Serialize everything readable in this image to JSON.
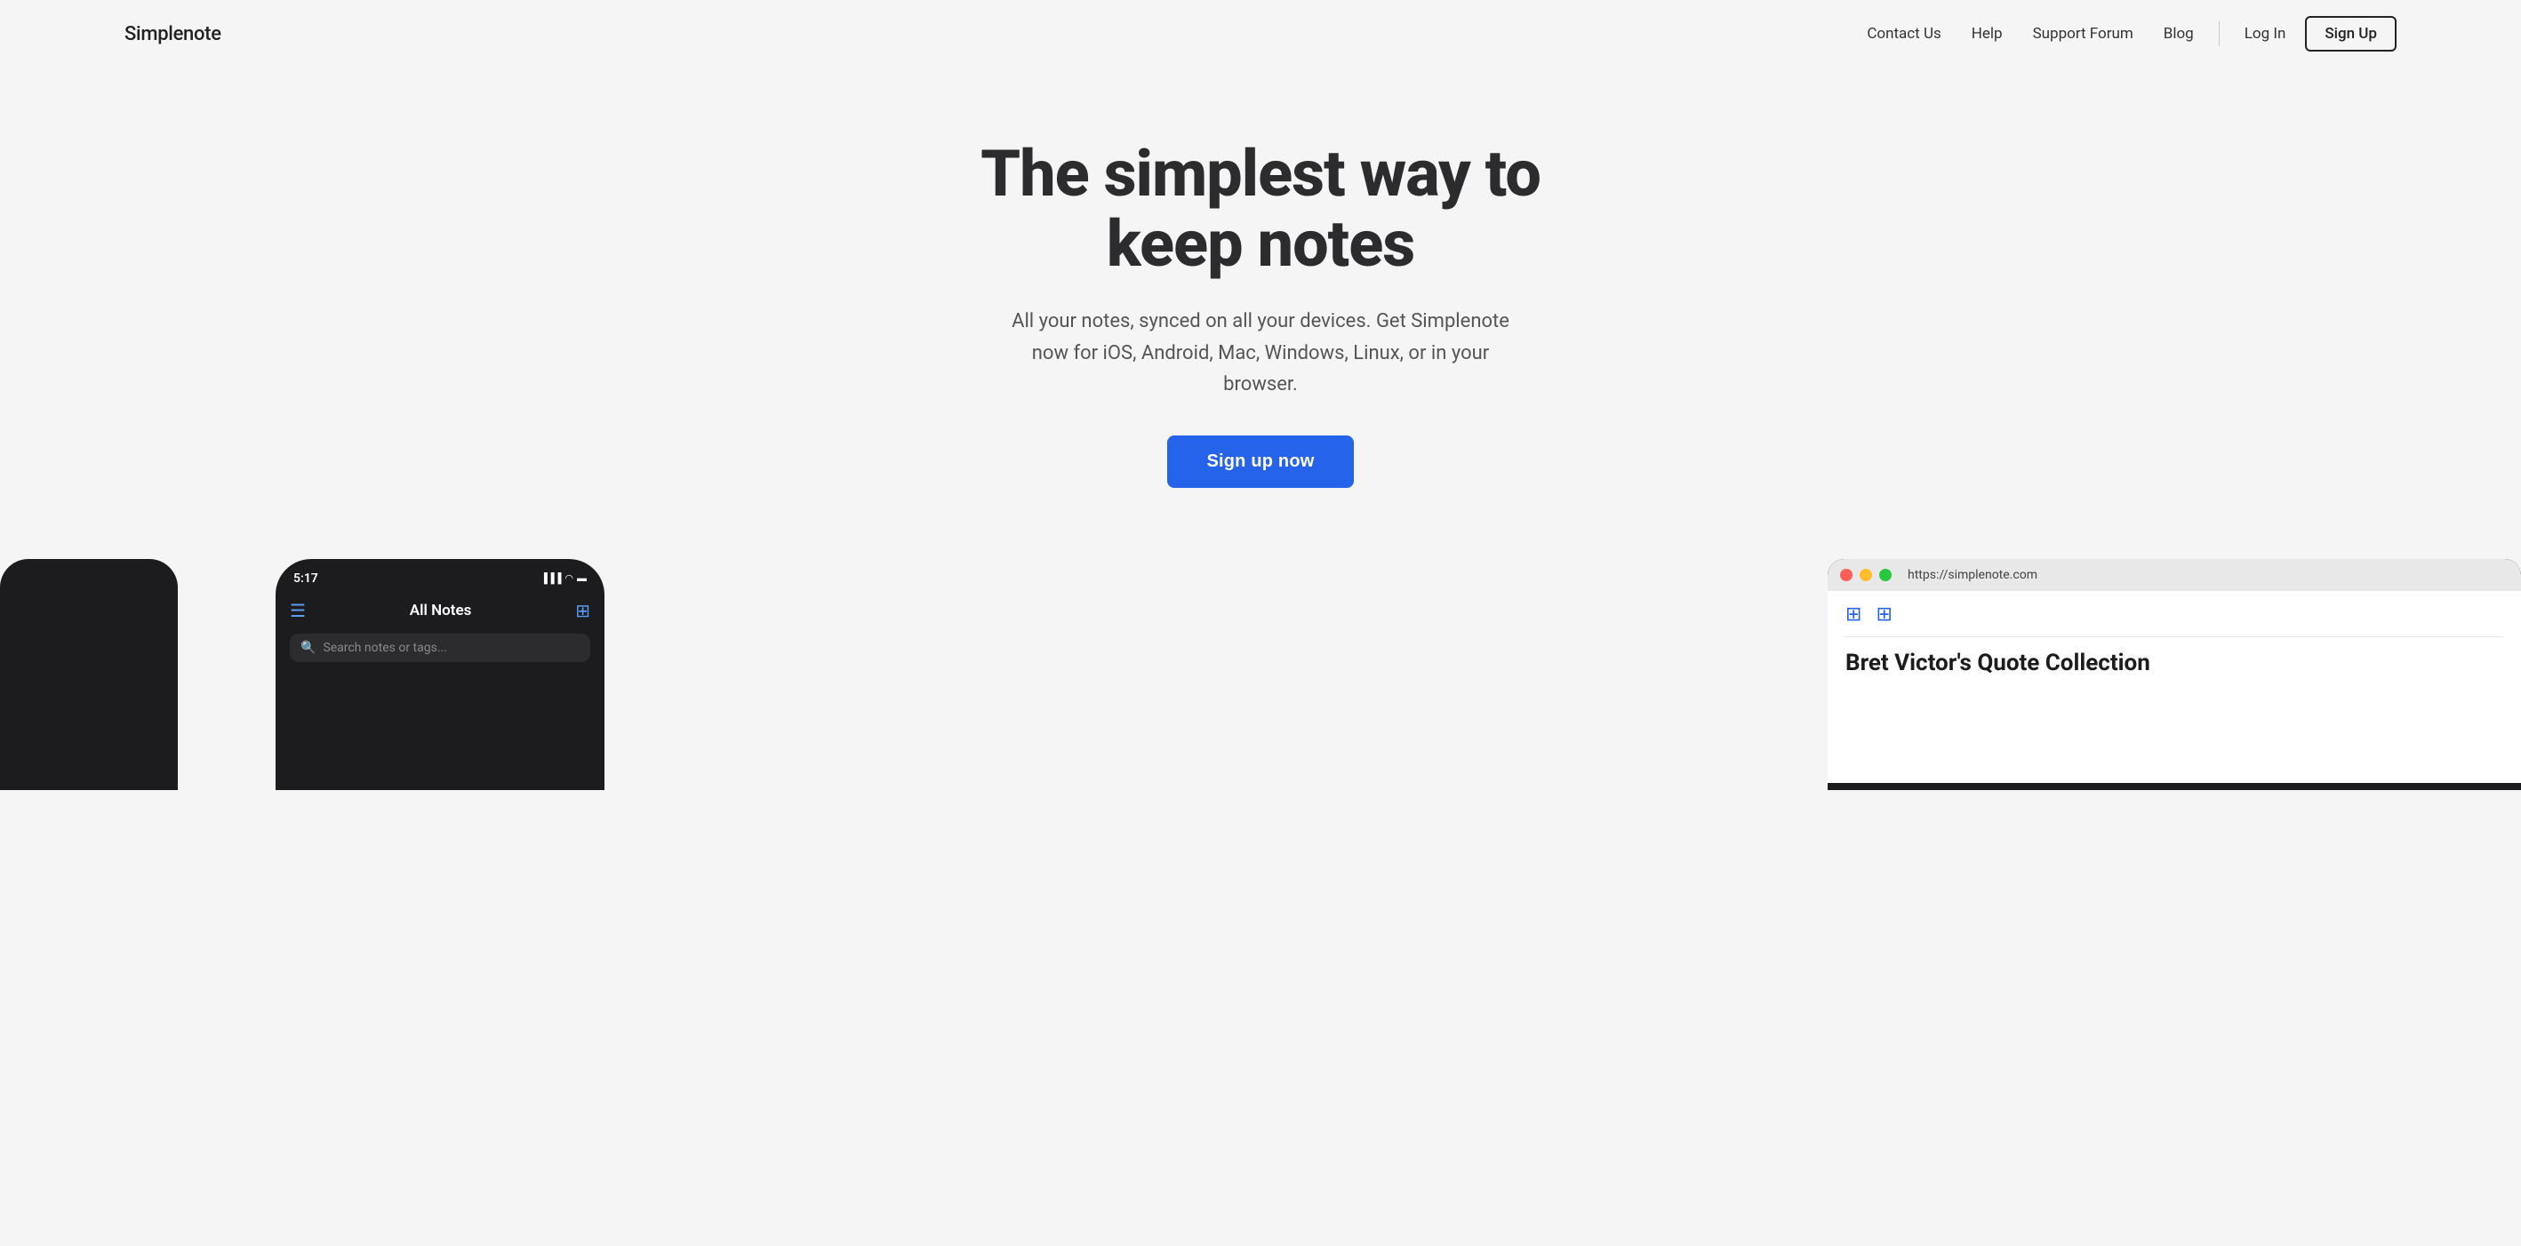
{
  "nav": {
    "logo": "Simplenote",
    "links": [
      {
        "id": "contact-us",
        "label": "Contact Us"
      },
      {
        "id": "help",
        "label": "Help"
      },
      {
        "id": "support-forum",
        "label": "Support Forum"
      },
      {
        "id": "blog",
        "label": "Blog"
      }
    ],
    "login_label": "Log In",
    "signup_label": "Sign Up"
  },
  "hero": {
    "title": "The simplest way to keep notes",
    "subtitle": "All your notes, synced on all your devices. Get Simplenote now for iOS, Android, Mac, Windows, Linux, or in your browser.",
    "cta_label": "Sign up now"
  },
  "phone": {
    "time": "5:17",
    "header_title": "All Notes",
    "search_placeholder": "Search notes or tags..."
  },
  "browser": {
    "url": "https://simplenote.com",
    "content_title": "Bret Victor's Quote Collection"
  }
}
